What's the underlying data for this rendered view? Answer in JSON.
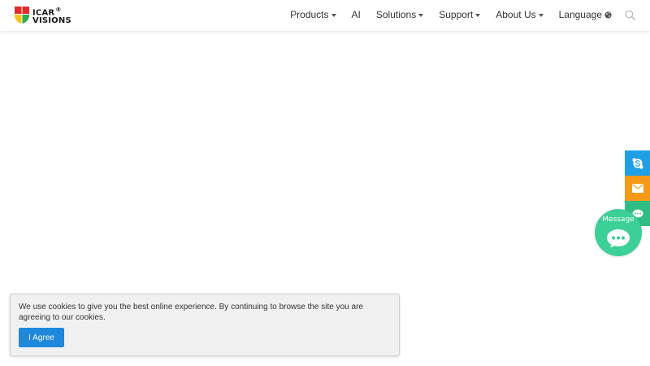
{
  "header": {
    "logo": {
      "line1": "ICAR",
      "reg": "®",
      "line2": "VISIONS",
      "colors": [
        "#e52a2a",
        "#f4c21a",
        "#2cae4a"
      ]
    },
    "nav": [
      {
        "label": "Products",
        "dropdown": true
      },
      {
        "label": "AI",
        "dropdown": false
      },
      {
        "label": "Solutions",
        "dropdown": true
      },
      {
        "label": "Support",
        "dropdown": true
      },
      {
        "label": "About Us",
        "dropdown": true
      },
      {
        "label": "Language",
        "icon": "globe-icon"
      }
    ],
    "search_icon": "search-icon"
  },
  "side_contact": {
    "items": [
      {
        "icon": "skype-icon",
        "color": "#1e9fe6"
      },
      {
        "icon": "mail-icon",
        "color": "#f59a17"
      },
      {
        "icon": "chat-icon",
        "color": "#2fbd83"
      }
    ]
  },
  "message_widget": {
    "label": "Message",
    "color": "#3ccf97"
  },
  "cookie": {
    "text": "We use cookies to give you the best online experience. By continuing to browse the site you are agreeing to our cookies.",
    "agree_label": "I Agree"
  }
}
